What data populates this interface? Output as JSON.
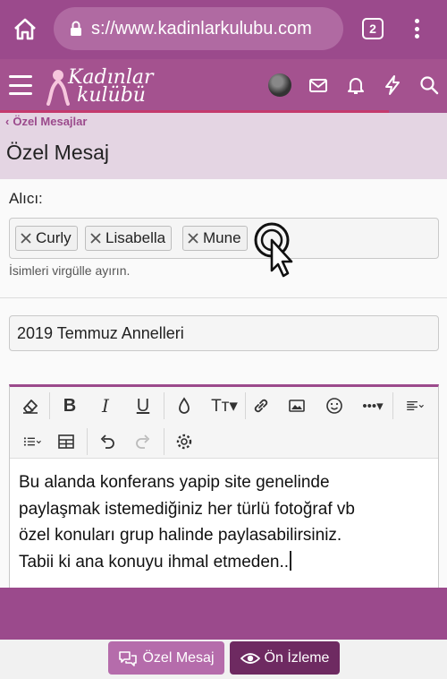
{
  "browser": {
    "url": "s://www.kadinlarkulubu.com",
    "tab_count": "2"
  },
  "site": {
    "logo_line1": "Kadınlar",
    "logo_line2": "kulübü"
  },
  "breadcrumb": "Özel Mesajlar",
  "page_title": "Özel Mesaj",
  "form": {
    "recipient_label": "Alıcı:",
    "recipients": [
      "Curly",
      "Lisabella",
      "Mune"
    ],
    "recipient_hint": "İsimleri virgülle ayırın.",
    "subject_value": "2019 Temmuz Annelleri",
    "body_lines": [
      "Bu alanda konferans yapip site genelinde",
      "paylaşmak istemediğiniz her türlü fotoğraf vb",
      "özel konuları grup halinde paylasabilirsiniz.",
      "Tabii ki ana konuyu ihmal etmeden.."
    ]
  },
  "buttons": {
    "send": "Özel Mesaj",
    "preview": "Ön İzleme"
  },
  "colors": {
    "brand": "#9b4a8c",
    "brand_dark": "#6e2a61",
    "band": "#e4d5e3"
  },
  "icons": {
    "editor_toolbar": [
      "eraser-icon",
      "bold-icon",
      "italic-icon",
      "underline-icon",
      "text-color-icon",
      "font-size-icon",
      "link-icon",
      "image-icon",
      "smiley-icon",
      "more-icon",
      "align-icon",
      "list-icon",
      "table-icon",
      "undo-icon",
      "redo-icon",
      "settings-icon"
    ]
  }
}
